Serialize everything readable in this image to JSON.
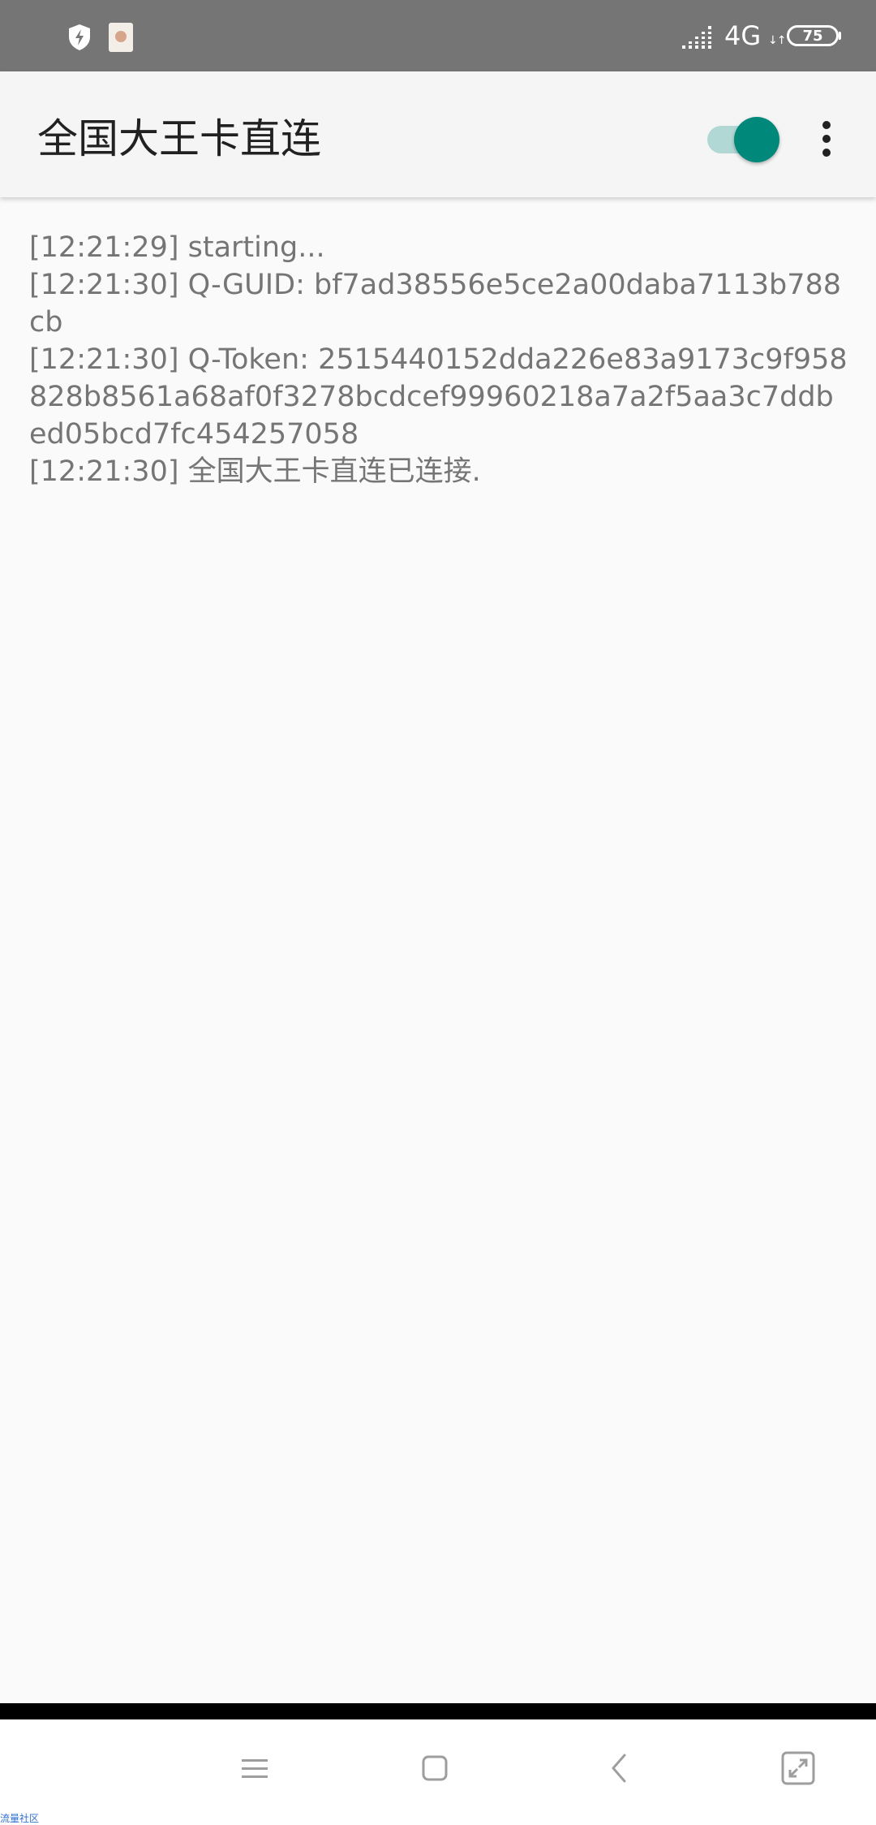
{
  "status_bar": {
    "network_type": "4G",
    "network_arrows": "↓↑",
    "battery_level": "75",
    "icons": [
      "shield-bolt-icon",
      "app-notification-icon",
      "signal-icon",
      "battery-icon"
    ]
  },
  "app_bar": {
    "title": "全国大王卡直连",
    "toggle_on": true,
    "accent_color": "#00897b",
    "icons": [
      "toggle-switch",
      "more-vert-icon"
    ]
  },
  "log": {
    "lines": [
      "[12:21:29] starting...",
      "[12:21:30] Q-GUID: bf7ad38556e5ce2a00daba7113b788cb",
      "[12:21:30] Q-Token: 2515440152dda226e83a9173c9f958828b8561a68af0f3278bcdcef99960218a7a2f5aa3c7ddbed05bcd7fc454257058",
      "[12:21:30] 全国大王卡直连已连接."
    ]
  },
  "nav_bar": {
    "icons": [
      "menu-icon",
      "home-icon",
      "back-icon",
      "fullscreen-icon"
    ]
  },
  "watermark": {
    "text": "流量社区"
  }
}
